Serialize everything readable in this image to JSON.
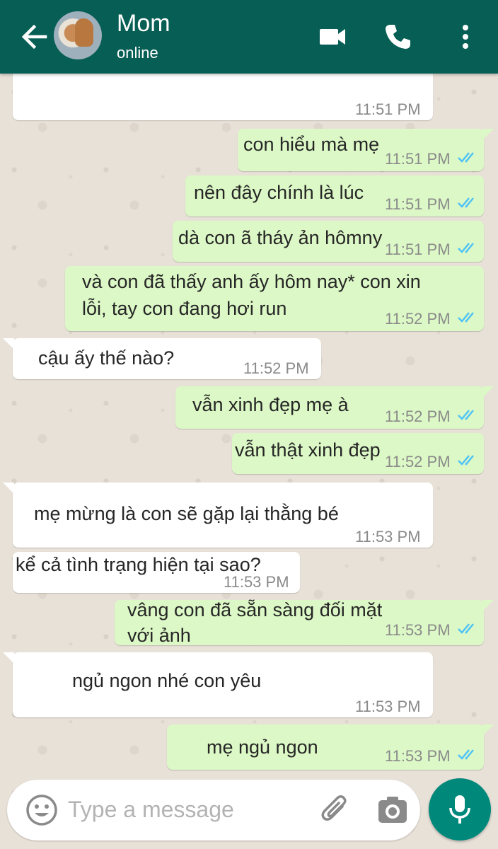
{
  "header": {
    "contact_name": "Mom",
    "status": "online",
    "background_color": "#075e54"
  },
  "colors": {
    "incoming_bubble": "#ffffff",
    "outgoing_bubble": "#dcf8c6",
    "read_ticks": "#4fc3f7",
    "mic_button": "#00897b"
  },
  "messages": [
    {
      "direction": "in",
      "text": "",
      "time": "11:51 PM"
    },
    {
      "direction": "out",
      "text": "con hiểu mà mẹ",
      "time": "11:51 PM",
      "status": "read"
    },
    {
      "direction": "out",
      "text": "nên đây chính là lúc",
      "time": "11:51 PM",
      "status": "read"
    },
    {
      "direction": "out",
      "text": "dà con ã tháy ản hômny",
      "time": "11:51 PM",
      "status": "read"
    },
    {
      "direction": "out",
      "text_lines": [
        "và con đã thấy anh ấy hôm nay* con xin",
        "lỗi, tay con đang hơi run"
      ],
      "time": "11:52 PM",
      "status": "read"
    },
    {
      "direction": "in",
      "text": "cậu ấy thế nào?",
      "time": "11:52 PM"
    },
    {
      "direction": "out",
      "text": "vẫn xinh đẹp mẹ à",
      "time": "11:52 PM",
      "status": "read"
    },
    {
      "direction": "out",
      "text": "vẫn thật xinh đẹp",
      "time": "11:52 PM",
      "status": "read"
    },
    {
      "direction": "in",
      "text": "mẹ mừng là con sẽ gặp lại thằng bé",
      "time": "11:53 PM"
    },
    {
      "direction": "in",
      "text": "kể cả tình trạng hiện tại sao?",
      "time": "11:53 PM"
    },
    {
      "direction": "out",
      "text_lines": [
        "vâng con đã sẵn sàng đối mặt",
        "với ảnh"
      ],
      "time": "11:53 PM",
      "status": "read"
    },
    {
      "direction": "in",
      "text": "ngủ ngon nhé con yêu",
      "time": "11:53 PM"
    },
    {
      "direction": "out",
      "text": "mẹ ngủ ngon",
      "time": "11:53 PM",
      "status": "read"
    }
  ],
  "composer": {
    "placeholder": "Type a message"
  },
  "icons": [
    "back-arrow-icon",
    "video-call-icon",
    "phone-icon",
    "more-options-icon",
    "emoji-icon",
    "attach-icon",
    "camera-icon",
    "mic-icon",
    "double-check-icon"
  ]
}
